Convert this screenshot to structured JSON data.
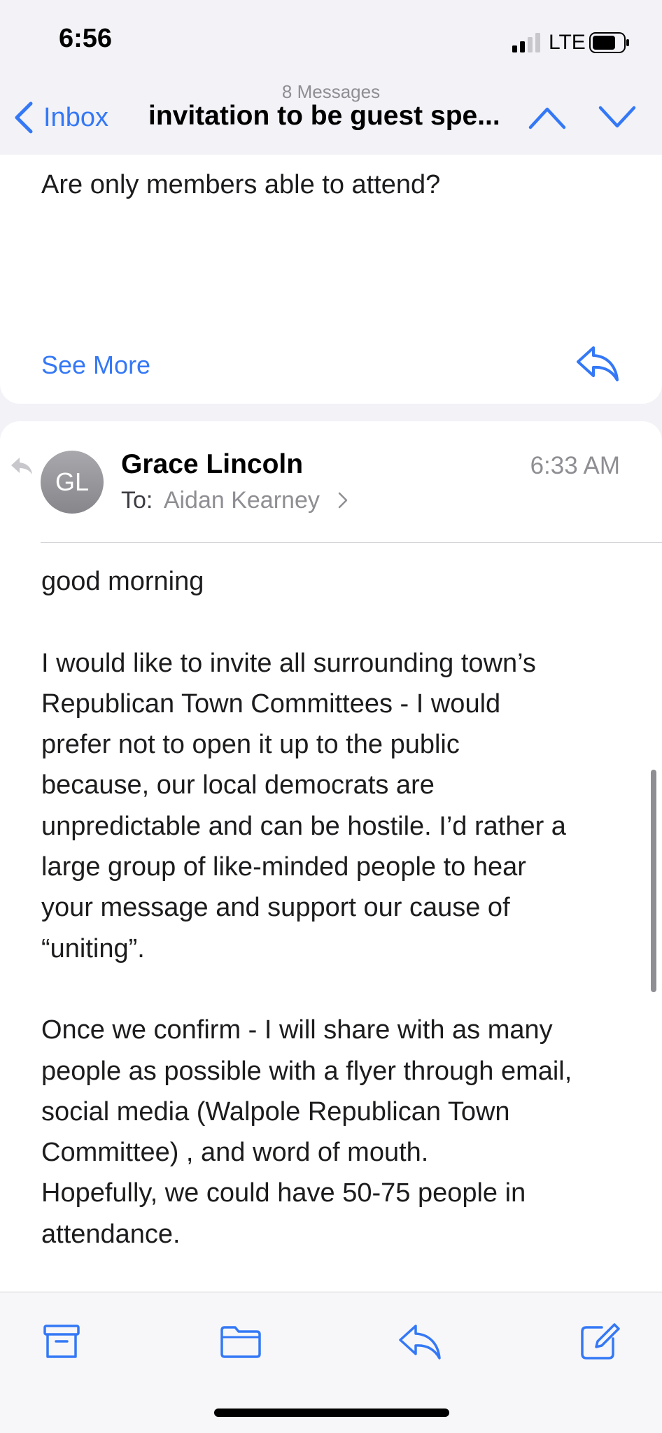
{
  "status_bar": {
    "time": "6:56",
    "network": "LTE",
    "signal_icon": "cellular-signal-icon",
    "battery_icon": "battery-icon"
  },
  "nav": {
    "back_label": "Inbox",
    "message_count": "8 Messages",
    "title": "invitation to be guest spe...",
    "back_icon": "chevron-left-icon",
    "prev_icon": "chevron-up-icon",
    "next_icon": "chevron-down-icon"
  },
  "previous_message": {
    "text": "Are only members able to attend?",
    "see_more_label": "See More",
    "reply_icon": "reply-arrow-icon"
  },
  "message": {
    "avatar_initials": "GL",
    "sender": "Grace Lincoln",
    "time": "6:33 AM",
    "to_label": "To:",
    "recipient": "Aidan Kearney",
    "replied_icon": "replied-arrow-icon",
    "body_lines": [
      "good morning",
      "",
      "I would like to invite all surrounding town’s",
      "Republican Town Committees - I would",
      "prefer not to open it up to the public",
      "because, our local democrats are",
      "unpredictable and can be hostile. I’d rather a",
      "large group of like-minded people to hear",
      "your message and support our cause of",
      "“uniting”.",
      "",
      "Once we confirm - I will share with as many",
      "people as possible with a flyer through email,",
      "social media (Walpole Republican Town",
      "Committee) , and word of mouth.",
      "Hopefully, we could have 50-75 people in",
      "attendance."
    ]
  },
  "toolbar": {
    "archive_icon": "archive-icon",
    "folder_icon": "folder-icon",
    "reply_icon": "reply-icon",
    "compose_icon": "compose-icon"
  },
  "colors": {
    "accent": "#3478f6",
    "secondary_text": "#8e8e93",
    "background": "#f2f2f7"
  }
}
